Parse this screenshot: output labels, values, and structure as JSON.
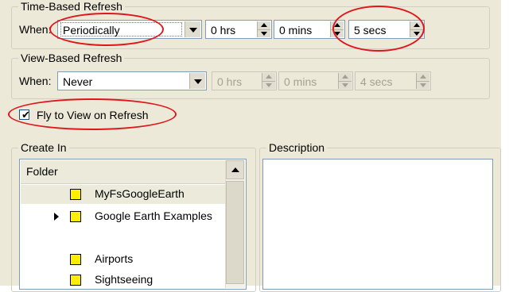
{
  "time_refresh": {
    "group_label": "Time-Based Refresh",
    "when_label": "When:",
    "when_value": "Periodically",
    "hours_value": "0 hrs",
    "mins_value": "0 mins",
    "secs_value": "5 secs"
  },
  "view_refresh": {
    "group_label": "View-Based Refresh",
    "when_label": "When:",
    "when_value": "Never",
    "hours_value": "0 hrs",
    "mins_value": "0 mins",
    "secs_value": "4 secs"
  },
  "fly_to_view": {
    "label": "Fly to View on Refresh",
    "checked": true,
    "check_glyph": "✔"
  },
  "create_in": {
    "group_label": "Create In",
    "column_header": "Folder",
    "items": [
      {
        "label": "MyFsGoogleEarth",
        "icon": "folder-icon",
        "selected": true
      },
      {
        "label": "Google Earth Examples",
        "icon": "folder-icon",
        "expandable": true
      },
      {
        "label": "Airports",
        "icon": "folder-icon"
      },
      {
        "label": "Sightseeing",
        "icon": "folder-icon"
      }
    ]
  },
  "description": {
    "group_label": "Description"
  },
  "colors": {
    "dialog_bg": "#ece9d8",
    "highlight_oval": "#e0161b",
    "folder_icon": "#ffee00"
  }
}
